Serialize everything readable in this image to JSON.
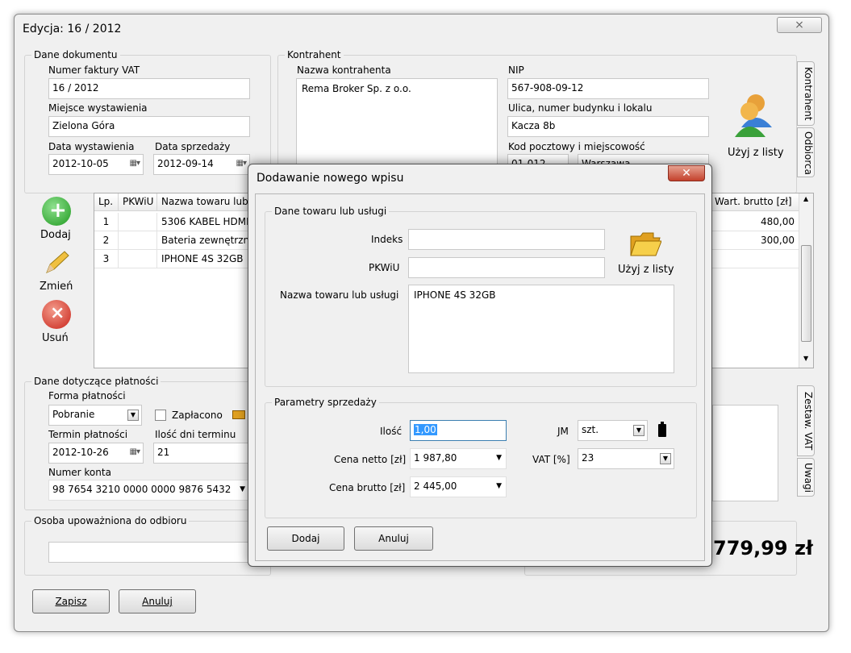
{
  "window": {
    "title": "Edycja: 16 / 2012",
    "close": "⨯"
  },
  "doc": {
    "group": "Dane dokumentu",
    "invoice_label": "Numer faktury VAT",
    "invoice_value": "16 / 2012",
    "place_label": "Miejsce wystawienia",
    "place_value": "Zielona Góra",
    "issue_label": "Data wystawienia",
    "issue_value": "2012-10-05",
    "sale_label": "Data sprzedaży",
    "sale_value": "2012-09-14"
  },
  "contractor": {
    "group": "Kontrahent",
    "name_label": "Nazwa kontrahenta",
    "name_value": "Rema Broker Sp. z o.o.",
    "nip_label": "NIP",
    "nip_value": "567-908-09-12",
    "street_label": "Ulica, numer budynku i lokalu",
    "street_value": "Kacza 8b",
    "postal_label": "Kod pocztowy i miejscowość",
    "postal_value": "01-012",
    "city_value": "Warszawa",
    "use_list": "Użyj z listy"
  },
  "side_tabs": {
    "kontrahent": "Kontrahent",
    "odbiorca": "Odbiorca",
    "zestaw": "Zestaw. VAT",
    "uwagi": "Uwagi"
  },
  "actions": {
    "add": "Dodaj",
    "edit": "Zmień",
    "delete": "Usuń"
  },
  "table": {
    "headers": {
      "lp": "Lp.",
      "pkwiu": "PKWiU",
      "name": "Nazwa towaru lub usługi",
      "gross": "Wart. brutto [zł]"
    },
    "rows": [
      {
        "lp": "1",
        "pkwiu": "",
        "name": "5306 KABEL HDMI",
        "gross": "480,00"
      },
      {
        "lp": "2",
        "pkwiu": "",
        "name": "Bateria zewnętrzna",
        "gross": "300,00"
      },
      {
        "lp": "3",
        "pkwiu": "",
        "name": "IPHONE 4S 32GB",
        "gross": ""
      }
    ]
  },
  "payment": {
    "group": "Dane dotyczące płatności",
    "form_label": "Forma płatności",
    "form_value": "Pobranie",
    "paid_label": "Zapłacono",
    "due_label": "Termin płatności",
    "due_value": "2012-10-26",
    "days_label": "Ilość dni terminu",
    "days_value": "21",
    "account_label": "Numer konta",
    "account_value": "98 7654 3210 0000 0000 9876 5432"
  },
  "receiver": {
    "group": "Osoba upoważniona do odbioru",
    "value": ""
  },
  "total": "779,99 zł",
  "bottom": {
    "save": "Zapisz",
    "cancel": "Anuluj"
  },
  "dialog": {
    "title": "Dodawanie nowego wpisu",
    "product_group": "Dane towaru lub usługi",
    "index_label": "Indeks",
    "index_value": "",
    "pkwiu_label": "PKWiU",
    "pkwiu_value": "",
    "name_label": "Nazwa towaru lub usługi",
    "name_value": "IPHONE 4S 32GB",
    "use_list": "Użyj z listy",
    "sale_group": "Parametry sprzedaży",
    "qty_label": "Ilość",
    "qty_value": "1,00",
    "net_label": "Cena netto [zł]",
    "net_value": "1 987,80",
    "gross_label": "Cena brutto [zł]",
    "gross_value": "2 445,00",
    "unit_label": "JM",
    "unit_value": "szt.",
    "vat_label": "VAT [%]",
    "vat_value": "23",
    "add": "Dodaj",
    "cancel": "Anuluj"
  }
}
